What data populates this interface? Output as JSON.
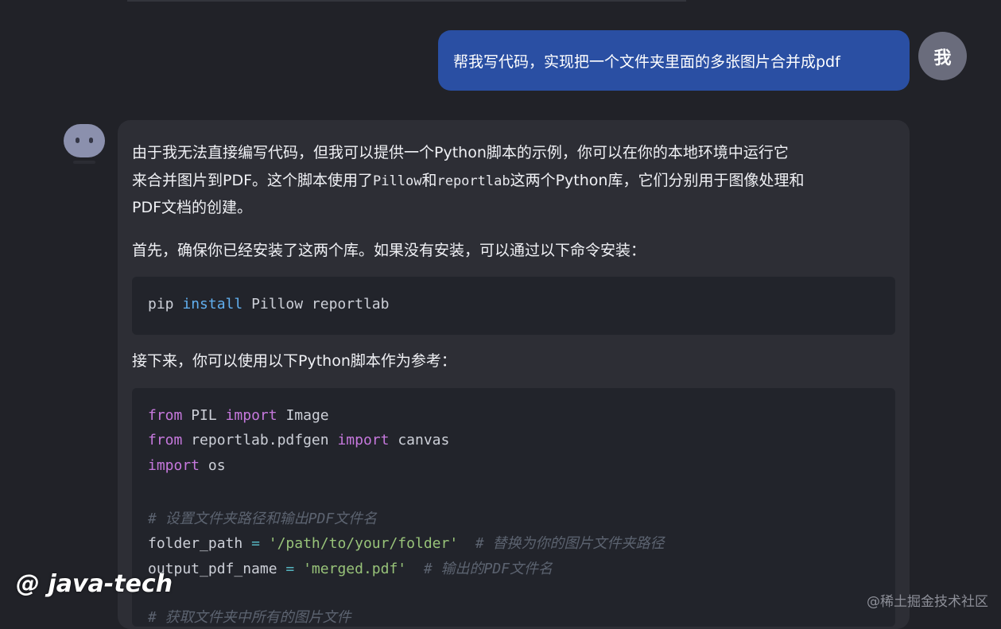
{
  "user": {
    "avatar_text": "我",
    "message": "帮我写代码，实现把一个文件夹里面的多张图片合并成pdf"
  },
  "assistant": {
    "paragraph1": {
      "line1": "由于我无法直接编写代码，但我可以提供一个Python脚本的示例，你可以在你的本地环境中运行它",
      "line2_a": "来合并图片到PDF。这个脚本使用了",
      "line2_code1": "Pillow",
      "line2_b": "和",
      "line2_code2": "reportlab",
      "line2_c": "这两个Python库，它们分别用于图像处理和",
      "line3": "PDF文档的创建。"
    },
    "paragraph2": "首先，确保你已经安装了这两个库。如果没有安装，可以通过以下命令安装：",
    "install_code": {
      "cmd": "pip",
      "sub": "install",
      "args": "Pillow reportlab"
    },
    "paragraph3": "接下来，你可以使用以下Python脚本作为参考：",
    "script_code": {
      "l1_kw1": "from",
      "l1_mod": "PIL",
      "l1_kw2": "import",
      "l1_name": "Image",
      "l2_kw1": "from",
      "l2_mod": "reportlab.pdfgen",
      "l2_kw2": "import",
      "l2_name": "canvas",
      "l3_kw": "import",
      "l3_name": "os",
      "l5_comment": "# 设置文件夹路径和输出PDF文件名",
      "l6_var": "folder_path",
      "l6_op": "=",
      "l6_str": "'/path/to/your/folder'",
      "l6_comment": "# 替换为你的图片文件夹路径",
      "l7_var": "output_pdf_name",
      "l7_op": "=",
      "l7_str": "'merged.pdf'",
      "l7_comment": "# 输出的PDF文件名",
      "l9_comment": "# 获取文件夹中所有的图片文件"
    }
  },
  "watermarks": {
    "left": "@ java-tech",
    "right": "@稀土掘金技术社区"
  },
  "colors": {
    "background": "#212228",
    "user_bubble": "#2a4fa3",
    "bot_bubble": "#2d2e35",
    "code_bg": "#22242b",
    "keyword": "#c678dd",
    "string": "#98c379",
    "comment": "#5c6370"
  }
}
